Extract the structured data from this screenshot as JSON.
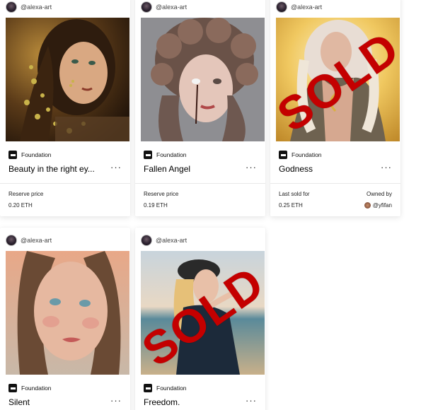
{
  "cards": [
    {
      "handle": "@alexa-art",
      "platform": "Foundation",
      "title": "Beauty in the right ey...",
      "more": "···",
      "price_label": "Reserve price",
      "price_value": "0.20 ETH",
      "sold": ""
    },
    {
      "handle": "@alexa-art",
      "platform": "Foundation",
      "title": "Fallen Angel",
      "more": "···",
      "price_label": "Reserve price",
      "price_value": "0.19 ETH",
      "sold": ""
    },
    {
      "handle": "@alexa-art",
      "platform": "Foundation",
      "title": "Godness",
      "more": "···",
      "price_label": "Last sold for",
      "price_value": "0.25 ETH",
      "owner_label": "Owned by",
      "owner_name": "@yfifan",
      "sold": "SOLD"
    },
    {
      "handle": "@alexa-art",
      "platform": "Foundation",
      "title": "Silent",
      "more": "···",
      "sold": ""
    },
    {
      "handle": "@alexa-art",
      "platform": "Foundation",
      "title": "Freedom.",
      "more": "···",
      "sold": "SOLD"
    }
  ],
  "icons": {
    "platform": "foundation-logo-icon",
    "more": "more-options-icon",
    "avatar": "creator-avatar"
  },
  "colors": {
    "sold_stamp": "#c40000",
    "card_bg": "#ffffff"
  }
}
